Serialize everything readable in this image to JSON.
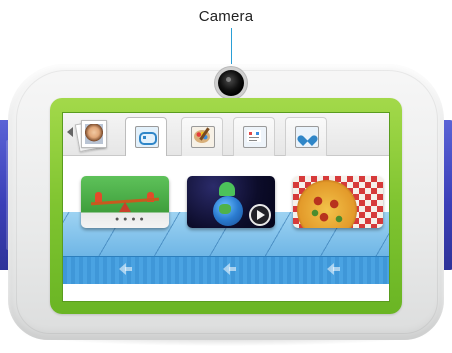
{
  "callout": {
    "label": "Camera"
  },
  "tablet": {
    "frame_color": "#7fc430",
    "bumper_color": "#3b3fb8",
    "body_color": "#ececec"
  },
  "tabs": [
    {
      "icon": "profile-photo-icon",
      "active": false
    },
    {
      "icon": "gamepad-icon",
      "active": true
    },
    {
      "icon": "palette-icon",
      "active": false
    },
    {
      "icon": "board-icon",
      "active": false
    },
    {
      "icon": "heart-icon",
      "active": false
    }
  ],
  "apps": [
    {
      "icon": "seesaw-game-icon"
    },
    {
      "icon": "space-dinosaur-video-icon"
    },
    {
      "icon": "pizza-game-icon"
    }
  ],
  "shelf": {
    "color": "#4aa3e2",
    "arrow_icon": "left-arrow-icon"
  }
}
